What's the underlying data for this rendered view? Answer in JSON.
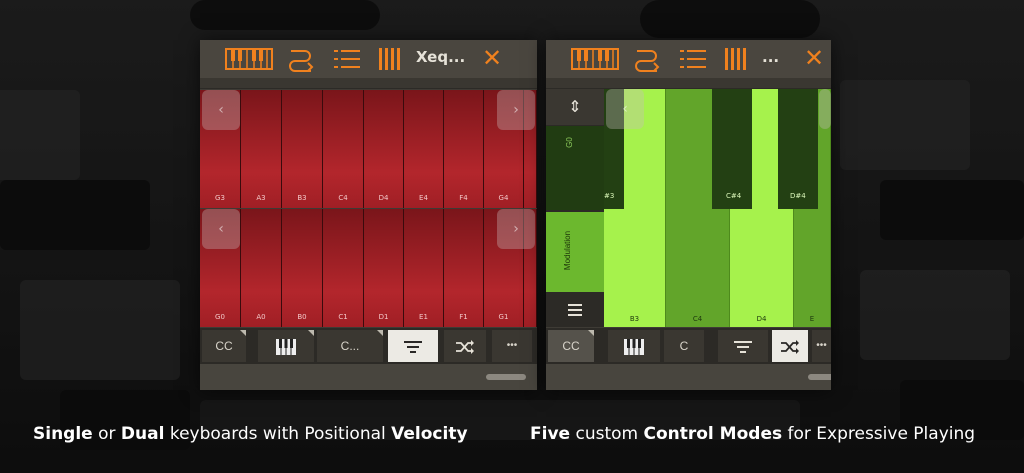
{
  "left_panel": {
    "title": "Xeq...",
    "toolbar_icons": [
      "keyboard-icon",
      "route-icon",
      "list-icon",
      "bars-icon"
    ],
    "close_glyph": "✕",
    "nav_prev": "‹",
    "nav_next": "›",
    "top_keys": [
      "G3",
      "A3",
      "B3",
      "C4",
      "D4",
      "E4",
      "F4",
      "G4"
    ],
    "bottom_keys": [
      "G0",
      "A0",
      "B0",
      "C1",
      "D1",
      "E1",
      "F1",
      "G1"
    ],
    "bottom_buttons": {
      "cc": "CC",
      "c": "C...",
      "more": "•••"
    },
    "active_button": "filter"
  },
  "right_panel": {
    "title": "...",
    "close_glyph": "✕",
    "nav_prev": "‹",
    "side_labels": {
      "go": "G0",
      "modulation": "Modulation"
    },
    "black_key_labels": [
      "#3",
      "C#4",
      "D#4"
    ],
    "white_key_labels": [
      "B3",
      "C4",
      "D4",
      "E"
    ],
    "bottom_buttons": {
      "cc": "CC",
      "c": "C",
      "more": "•••"
    },
    "active_button": "shuffle"
  },
  "captions": {
    "left": {
      "p1": "Single",
      "p2": " or ",
      "p3": "Dual",
      "p4": " keyboards with Positional ",
      "p5": "Velocity"
    },
    "right": {
      "p1": "Five",
      "p2": " custom ",
      "p3": "Control Modes",
      "p4": " for Expressive Playing"
    }
  },
  "colors": {
    "accent": "#f0811e",
    "red_key": "#b3262c",
    "green_key": "#a6f24c"
  }
}
